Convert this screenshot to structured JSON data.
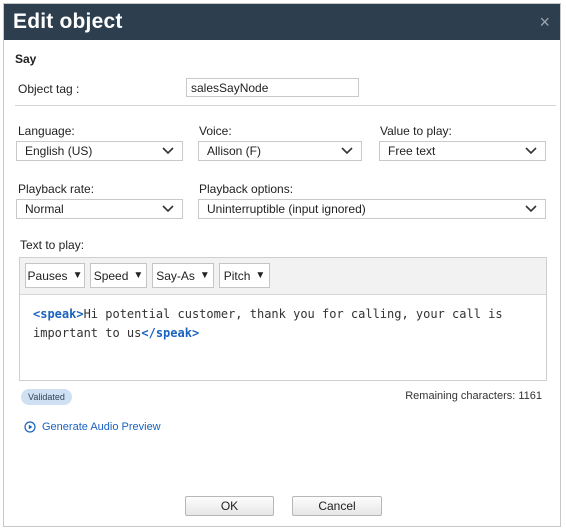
{
  "dialog": {
    "title": "Edit object",
    "close_glyph": "×"
  },
  "section": "Say",
  "object_tag": {
    "label": "Object tag :",
    "value": "salesSayNode"
  },
  "language": {
    "label": "Language:",
    "value": "English (US)"
  },
  "voice": {
    "label": "Voice:",
    "value": "Allison (F)"
  },
  "value_to_play": {
    "label": "Value to play:",
    "value": "Free text"
  },
  "playback_rate": {
    "label": "Playback rate:",
    "value": "Normal"
  },
  "playback_options": {
    "label": "Playback options:",
    "value": "Uninterruptible (input ignored)"
  },
  "text_to_play": {
    "label": "Text to play:",
    "toolbar": [
      "Pauses",
      "Speed",
      "Say-As",
      "Pitch"
    ],
    "open_tag": "<speak>",
    "text": "Hi potential customer, thank you for calling, your call is important to us",
    "close_tag": "</speak>"
  },
  "status": {
    "badge": "Validated",
    "remaining": "Remaining characters: 1161"
  },
  "preview": {
    "label": "Generate Audio Preview",
    "icon": "play-circle-icon"
  },
  "buttons": {
    "ok": "OK",
    "cancel": "Cancel"
  },
  "colors": {
    "titlebar": "#2d3e4e",
    "link": "#1a63c0",
    "badge_bg": "#cfe0f3"
  }
}
